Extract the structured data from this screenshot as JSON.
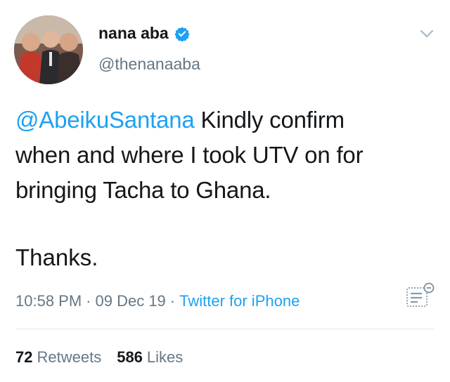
{
  "author": {
    "name": "nana aba",
    "handle": "@thenanaaba",
    "verified": true
  },
  "tweet": {
    "mention": "@AbeikuSantana",
    "line1_rest": " Kindly confirm",
    "line2": "when and where I took UTV on for",
    "line3": "bringing Tacha to Ghana.",
    "line4": "Thanks."
  },
  "meta": {
    "time": "10:58 PM",
    "date": "09 Dec 19",
    "separator": "·",
    "source": "Twitter for iPhone"
  },
  "stats": {
    "retweets_count": "72",
    "retweets_label": "Retweets",
    "likes_count": "586",
    "likes_label": "Likes"
  },
  "colors": {
    "accent": "#1da1f2",
    "text": "#14171a",
    "muted": "#657786"
  },
  "icons": [
    "verified-badge-icon",
    "chevron-down-icon",
    "tweet-analytics-icon"
  ]
}
